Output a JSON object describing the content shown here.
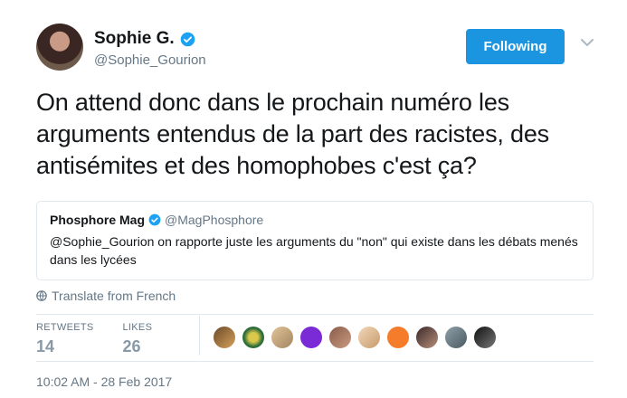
{
  "user": {
    "display_name": "Sophie G.",
    "screen_name": "@Sophie_Gourion",
    "follow_label": "Following"
  },
  "tweet": {
    "text": "On attend donc dans le prochain numéro les arguments entendus de la part des racistes, des antisémites et des homophobes c'est ça?"
  },
  "quoted": {
    "name": "Phosphore Mag",
    "handle": "@MagPhosphore",
    "text": "@Sophie_Gourion on rapporte juste les arguments du \"non\" qui existe dans les débats menés dans les lycées"
  },
  "translate_label": "Translate from French",
  "stats": {
    "retweets_label": "RETWEETS",
    "retweets_value": "14",
    "likes_label": "LIKES",
    "likes_value": "26"
  },
  "timestamp": "10:02 AM - 28 Feb 2017",
  "colors": {
    "accent": "#1b95e0",
    "muted": "#657786",
    "border": "#e1e8ed"
  }
}
